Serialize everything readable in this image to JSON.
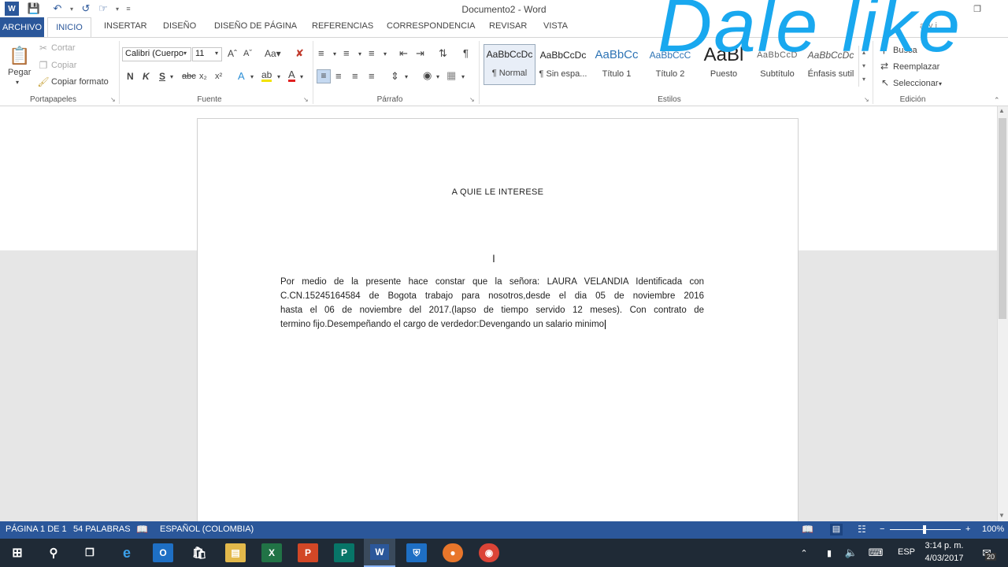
{
  "window": {
    "title": "Documento2 - Word"
  },
  "tabs": [
    "ARCHIVO",
    "INICIO",
    "INSERTAR",
    "DISEÑO",
    "DISEÑO DE PÁGINA",
    "REFERENCIAS",
    "CORRESPONDENCIA",
    "REVISAR",
    "VISTA"
  ],
  "user": "ally j",
  "clipboard": {
    "paste": "Pegar",
    "cut": "Cortar",
    "copy": "Copiar",
    "format_painter": "Copiar formato",
    "label": "Portapapeles"
  },
  "font": {
    "name": "Calibri (Cuerpo",
    "size": "11",
    "label": "Fuente",
    "bold": "N",
    "italic": "K",
    "underline": "S"
  },
  "paragraph": {
    "label": "Párrafo"
  },
  "styles": {
    "label": "Estilos",
    "items": [
      {
        "preview": "AaBbCcDc",
        "name": "¶ Normal"
      },
      {
        "preview": "AaBbCcDc",
        "name": "¶ Sin espa..."
      },
      {
        "preview": "AaBbCc",
        "name": "Título 1"
      },
      {
        "preview": "AaBbCcC",
        "name": "Título 2"
      },
      {
        "preview": "AaBl",
        "name": "Puesto"
      },
      {
        "preview": "AaBbCcD",
        "name": "Subtítulo"
      },
      {
        "preview": "AaBbCcDc",
        "name": "Énfasis sutil"
      }
    ]
  },
  "editing": {
    "find": "Busca",
    "replace": "Reemplazar",
    "select": "Seleccionar",
    "label": "Edición"
  },
  "document": {
    "heading": "A  QUIE LE  INTERESE",
    "lines": [
      "Por medio de la presente hace constar  que   la señora: LAURA VELANDIA Identificada con",
      "C.CN.15245164584 de  Bogota trabajo para  nosotros,desde el dia  05   de noviembre 2016",
      "hasta el  06 de noviembre del  2017.(lapso de tiempo servido 12 meses). Con  contrato de",
      "termino fijo.Desempeñando el cargo   de verdedor:Devengando un salario minimo"
    ]
  },
  "status": {
    "page": "PÁGINA 1 DE 1",
    "words": "54 PALABRAS",
    "language": "ESPAÑOL (COLOMBIA)",
    "zoom": "100%"
  },
  "taskbar": {
    "lang": "ESP",
    "time": "3:14 p. m.",
    "date": "4/03/2017",
    "notifications": "20"
  },
  "overlay": {
    "text": "Dale like"
  },
  "colors": {
    "accent": "#2b579a",
    "watermark": "#19a8ef",
    "taskbar": "#1f2a36"
  }
}
